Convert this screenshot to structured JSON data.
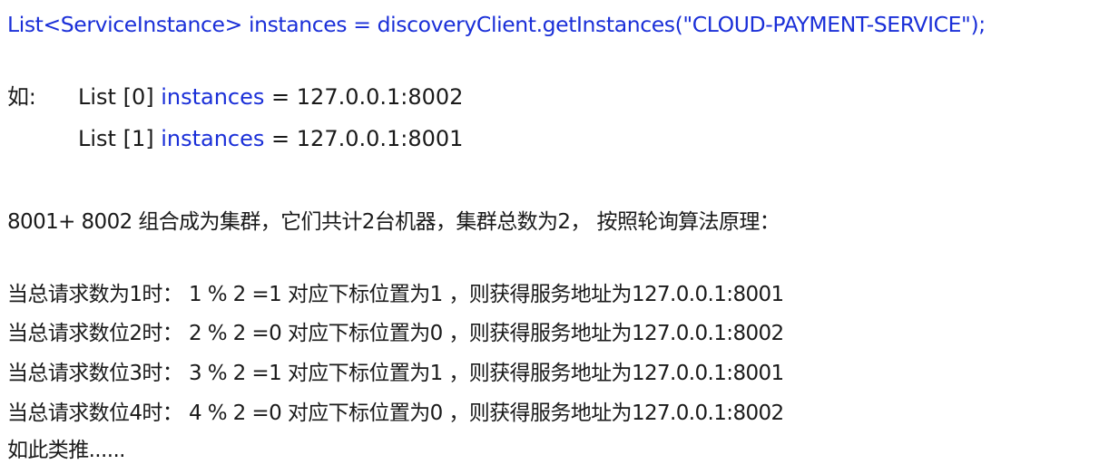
{
  "code_line": {
    "type": "List<ServiceInstance>",
    "var": "instances",
    "assign": "=",
    "call": "discoveryClient.getInstances(\"CLOUD-PAYMENT-SERVICE\");"
  },
  "example": {
    "label": "如:",
    "items": [
      {
        "prefix": "List [0]",
        "var": "instances",
        "rest": "= 127.0.0.1:8002"
      },
      {
        "prefix": "List [1]",
        "var": "instances",
        "rest": "= 127.0.0.1:8001"
      }
    ]
  },
  "summary": "8001+ 8002 组合成为集群，它们共计2台机器，集群总数为2， 按照轮询算法原理：",
  "rules": [
    "当总请求数为1时： 1 % 2 =1 对应下标位置为1 ，则获得服务地址为127.0.0.1:8001",
    "当总请求数位2时： 2 % 2 =0 对应下标位置为0 ，则获得服务地址为127.0.0.1:8002",
    "当总请求数位3时： 3 % 2 =1 对应下标位置为1 ，则获得服务地址为127.0.0.1:8001",
    "当总请求数位4时： 4 % 2 =0 对应下标位置为0 ，则获得服务地址为127.0.0.1:8002"
  ],
  "ending": "如此类推......"
}
